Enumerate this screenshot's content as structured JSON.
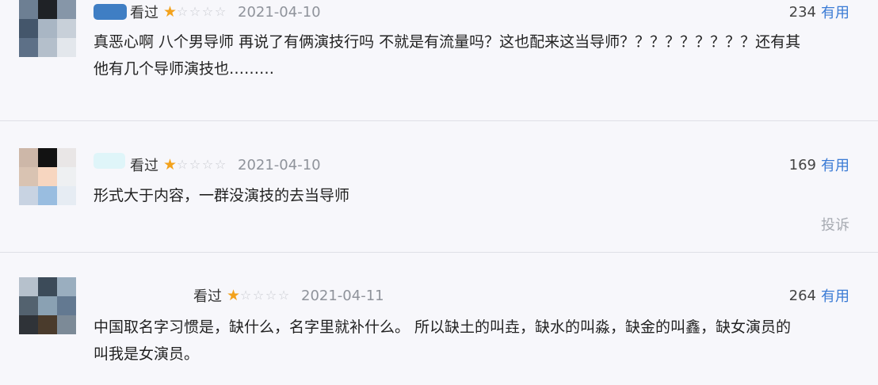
{
  "comments": [
    {
      "status": "看过",
      "rating": 1,
      "date": "2021-04-10",
      "votes": "234",
      "useful_label": "有用",
      "text_line1": "真恶心啊 八个男导师 再说了有俩演技行吗 不就是有流量吗？这也配来这当导师？？？？？？？？？还有其",
      "text_line2": "他有几个导师演技也………"
    },
    {
      "status": "看过",
      "rating": 1,
      "date": "2021-04-10",
      "votes": "169",
      "useful_label": "有用",
      "text_line1": "形式大于内容，一群没演技的去当导师",
      "report_label": "投诉"
    },
    {
      "status": "看过",
      "rating": 1,
      "date": "2021-04-11",
      "votes": "264",
      "useful_label": "有用",
      "text_line1": "中国取名字习惯是，缺什么，名字里就补什么。 所以缺土的叫垚，缺水的叫淼，缺金的叫鑫，缺女演员的",
      "text_line2": "叫我是女演员。"
    }
  ],
  "star_on": "★",
  "star_off": "☆",
  "colors": {
    "accent": "#3a7bd5",
    "star": "#f3a21c",
    "date": "#8f939b",
    "background": "#f7f7fb"
  }
}
